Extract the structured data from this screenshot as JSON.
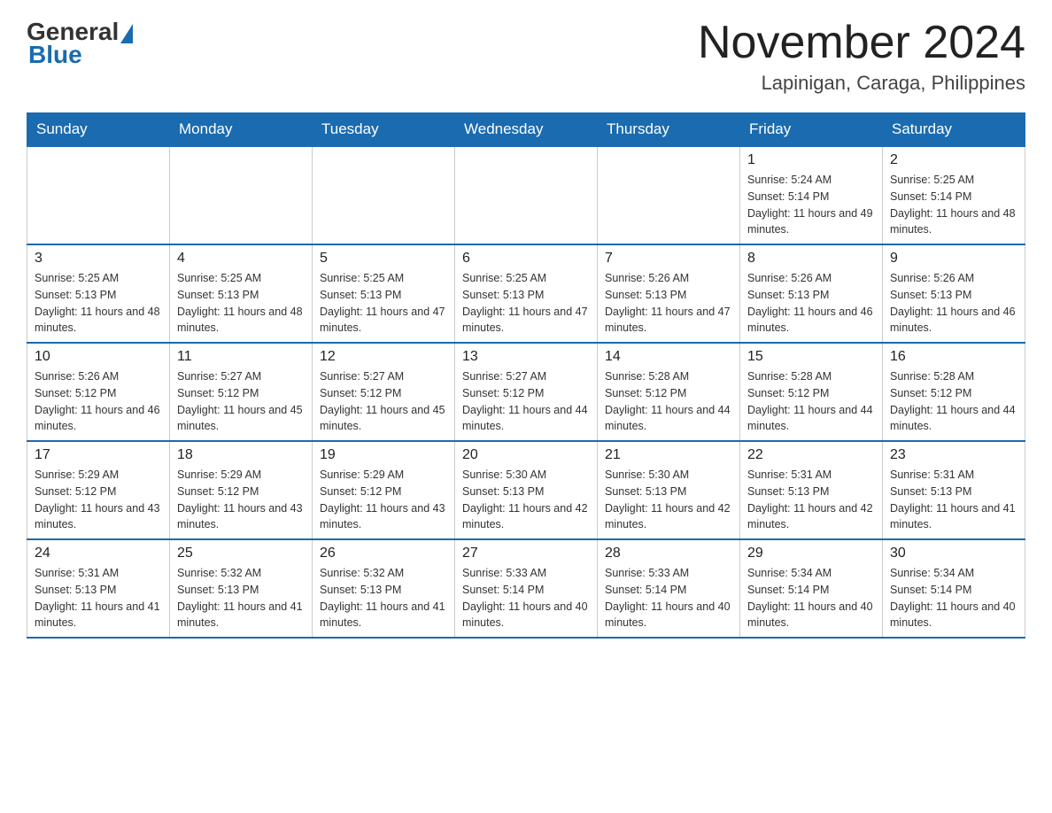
{
  "logo": {
    "general": "General",
    "blue": "Blue"
  },
  "header": {
    "month_year": "November 2024",
    "location": "Lapinigan, Caraga, Philippines"
  },
  "days_of_week": [
    "Sunday",
    "Monday",
    "Tuesday",
    "Wednesday",
    "Thursday",
    "Friday",
    "Saturday"
  ],
  "weeks": [
    [
      {
        "day": "",
        "sunrise": "",
        "sunset": "",
        "daylight": ""
      },
      {
        "day": "",
        "sunrise": "",
        "sunset": "",
        "daylight": ""
      },
      {
        "day": "",
        "sunrise": "",
        "sunset": "",
        "daylight": ""
      },
      {
        "day": "",
        "sunrise": "",
        "sunset": "",
        "daylight": ""
      },
      {
        "day": "",
        "sunrise": "",
        "sunset": "",
        "daylight": ""
      },
      {
        "day": "1",
        "sunrise": "Sunrise: 5:24 AM",
        "sunset": "Sunset: 5:14 PM",
        "daylight": "Daylight: 11 hours and 49 minutes."
      },
      {
        "day": "2",
        "sunrise": "Sunrise: 5:25 AM",
        "sunset": "Sunset: 5:14 PM",
        "daylight": "Daylight: 11 hours and 48 minutes."
      }
    ],
    [
      {
        "day": "3",
        "sunrise": "Sunrise: 5:25 AM",
        "sunset": "Sunset: 5:13 PM",
        "daylight": "Daylight: 11 hours and 48 minutes."
      },
      {
        "day": "4",
        "sunrise": "Sunrise: 5:25 AM",
        "sunset": "Sunset: 5:13 PM",
        "daylight": "Daylight: 11 hours and 48 minutes."
      },
      {
        "day": "5",
        "sunrise": "Sunrise: 5:25 AM",
        "sunset": "Sunset: 5:13 PM",
        "daylight": "Daylight: 11 hours and 47 minutes."
      },
      {
        "day": "6",
        "sunrise": "Sunrise: 5:25 AM",
        "sunset": "Sunset: 5:13 PM",
        "daylight": "Daylight: 11 hours and 47 minutes."
      },
      {
        "day": "7",
        "sunrise": "Sunrise: 5:26 AM",
        "sunset": "Sunset: 5:13 PM",
        "daylight": "Daylight: 11 hours and 47 minutes."
      },
      {
        "day": "8",
        "sunrise": "Sunrise: 5:26 AM",
        "sunset": "Sunset: 5:13 PM",
        "daylight": "Daylight: 11 hours and 46 minutes."
      },
      {
        "day": "9",
        "sunrise": "Sunrise: 5:26 AM",
        "sunset": "Sunset: 5:13 PM",
        "daylight": "Daylight: 11 hours and 46 minutes."
      }
    ],
    [
      {
        "day": "10",
        "sunrise": "Sunrise: 5:26 AM",
        "sunset": "Sunset: 5:12 PM",
        "daylight": "Daylight: 11 hours and 46 minutes."
      },
      {
        "day": "11",
        "sunrise": "Sunrise: 5:27 AM",
        "sunset": "Sunset: 5:12 PM",
        "daylight": "Daylight: 11 hours and 45 minutes."
      },
      {
        "day": "12",
        "sunrise": "Sunrise: 5:27 AM",
        "sunset": "Sunset: 5:12 PM",
        "daylight": "Daylight: 11 hours and 45 minutes."
      },
      {
        "day": "13",
        "sunrise": "Sunrise: 5:27 AM",
        "sunset": "Sunset: 5:12 PM",
        "daylight": "Daylight: 11 hours and 44 minutes."
      },
      {
        "day": "14",
        "sunrise": "Sunrise: 5:28 AM",
        "sunset": "Sunset: 5:12 PM",
        "daylight": "Daylight: 11 hours and 44 minutes."
      },
      {
        "day": "15",
        "sunrise": "Sunrise: 5:28 AM",
        "sunset": "Sunset: 5:12 PM",
        "daylight": "Daylight: 11 hours and 44 minutes."
      },
      {
        "day": "16",
        "sunrise": "Sunrise: 5:28 AM",
        "sunset": "Sunset: 5:12 PM",
        "daylight": "Daylight: 11 hours and 44 minutes."
      }
    ],
    [
      {
        "day": "17",
        "sunrise": "Sunrise: 5:29 AM",
        "sunset": "Sunset: 5:12 PM",
        "daylight": "Daylight: 11 hours and 43 minutes."
      },
      {
        "day": "18",
        "sunrise": "Sunrise: 5:29 AM",
        "sunset": "Sunset: 5:12 PM",
        "daylight": "Daylight: 11 hours and 43 minutes."
      },
      {
        "day": "19",
        "sunrise": "Sunrise: 5:29 AM",
        "sunset": "Sunset: 5:12 PM",
        "daylight": "Daylight: 11 hours and 43 minutes."
      },
      {
        "day": "20",
        "sunrise": "Sunrise: 5:30 AM",
        "sunset": "Sunset: 5:13 PM",
        "daylight": "Daylight: 11 hours and 42 minutes."
      },
      {
        "day": "21",
        "sunrise": "Sunrise: 5:30 AM",
        "sunset": "Sunset: 5:13 PM",
        "daylight": "Daylight: 11 hours and 42 minutes."
      },
      {
        "day": "22",
        "sunrise": "Sunrise: 5:31 AM",
        "sunset": "Sunset: 5:13 PM",
        "daylight": "Daylight: 11 hours and 42 minutes."
      },
      {
        "day": "23",
        "sunrise": "Sunrise: 5:31 AM",
        "sunset": "Sunset: 5:13 PM",
        "daylight": "Daylight: 11 hours and 41 minutes."
      }
    ],
    [
      {
        "day": "24",
        "sunrise": "Sunrise: 5:31 AM",
        "sunset": "Sunset: 5:13 PM",
        "daylight": "Daylight: 11 hours and 41 minutes."
      },
      {
        "day": "25",
        "sunrise": "Sunrise: 5:32 AM",
        "sunset": "Sunset: 5:13 PM",
        "daylight": "Daylight: 11 hours and 41 minutes."
      },
      {
        "day": "26",
        "sunrise": "Sunrise: 5:32 AM",
        "sunset": "Sunset: 5:13 PM",
        "daylight": "Daylight: 11 hours and 41 minutes."
      },
      {
        "day": "27",
        "sunrise": "Sunrise: 5:33 AM",
        "sunset": "Sunset: 5:14 PM",
        "daylight": "Daylight: 11 hours and 40 minutes."
      },
      {
        "day": "28",
        "sunrise": "Sunrise: 5:33 AM",
        "sunset": "Sunset: 5:14 PM",
        "daylight": "Daylight: 11 hours and 40 minutes."
      },
      {
        "day": "29",
        "sunrise": "Sunrise: 5:34 AM",
        "sunset": "Sunset: 5:14 PM",
        "daylight": "Daylight: 11 hours and 40 minutes."
      },
      {
        "day": "30",
        "sunrise": "Sunrise: 5:34 AM",
        "sunset": "Sunset: 5:14 PM",
        "daylight": "Daylight: 11 hours and 40 minutes."
      }
    ]
  ]
}
